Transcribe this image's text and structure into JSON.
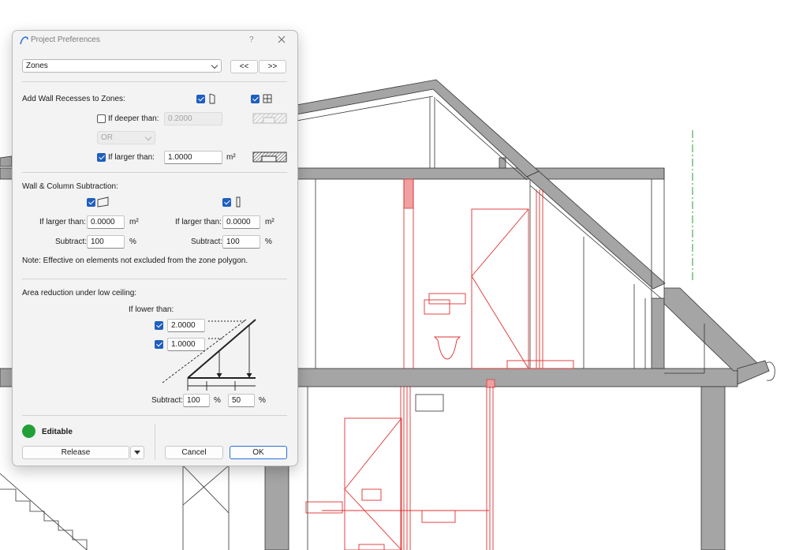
{
  "dialog": {
    "title": "Project Preferences",
    "help_label": "?",
    "panel_select": "Zones",
    "prev_label": "<<",
    "next_label": ">>"
  },
  "recesses": {
    "heading": "Add Wall Recesses to Zones:",
    "door_checked": true,
    "window_checked": true,
    "deeper_label": "If deeper than:",
    "deeper_checked": false,
    "deeper_value": "0.2000",
    "operator": "OR",
    "larger_label": "If larger than:",
    "larger_checked": true,
    "larger_value": "1.0000",
    "larger_unit": "m²"
  },
  "subtraction": {
    "heading": "Wall & Column Subtraction:",
    "wall": {
      "checked": true,
      "larger_label": "If larger than:",
      "larger_value": "0.0000",
      "unit": "m²",
      "subtract_label": "Subtract:",
      "subtract_value": "100",
      "percent": "%"
    },
    "column": {
      "checked": true,
      "larger_label": "If larger than:",
      "larger_value": "0.0000",
      "unit": "m²",
      "subtract_label": "Subtract:",
      "subtract_value": "100",
      "percent": "%"
    },
    "note": "Note: Effective on elements not excluded from the zone polygon."
  },
  "ceiling": {
    "heading": "Area reduction under low ceiling:",
    "lower_label": "If lower than:",
    "height1_checked": true,
    "height1": "2.0000",
    "height2_checked": true,
    "height2": "1.0000",
    "subtract_label": "Subtract:",
    "subtract1": "100",
    "subtract2": "50",
    "percent": "%"
  },
  "footer": {
    "status_label": "Editable",
    "status_color": "#21a038",
    "release_label": "Release",
    "cancel_label": "Cancel",
    "ok_label": "OK"
  },
  "colors": {
    "accent": "#1f5fbf",
    "drawing_red": "#e03030",
    "wall_gray": "#a5a5a5"
  }
}
